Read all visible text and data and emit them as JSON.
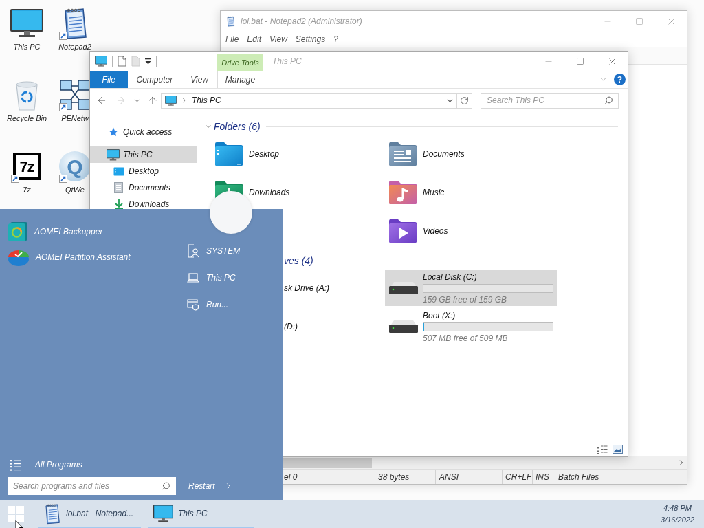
{
  "desktop": {
    "icons": [
      {
        "label": "This PC",
        "kind": "computer",
        "shortcut": false
      },
      {
        "label": "Recycle Bin",
        "kind": "recycle-bin",
        "shortcut": false
      },
      {
        "label": "7z",
        "kind": "archive",
        "shortcut": true,
        "logo_text": "7z"
      },
      {
        "label": "Notepad2",
        "kind": "notepad",
        "shortcut": true
      },
      {
        "label": "PENetw",
        "kind": "network",
        "shortcut": true
      },
      {
        "label": "QtWe",
        "kind": "bubble",
        "shortcut": true,
        "logo_text": "Q"
      }
    ]
  },
  "notepad": {
    "title": "lol.bat - Notepad2 (Administrator)",
    "menu": [
      "File",
      "Edit",
      "View",
      "Settings",
      "?"
    ],
    "status_bar": [
      "el 0",
      "38 bytes",
      "ANSI",
      "CR+LF",
      "INS",
      "Batch Files"
    ]
  },
  "explorer": {
    "title": "This PC",
    "contextual_group": "Drive Tools",
    "ribbon_tabs": [
      {
        "label": "File",
        "kind": "file"
      },
      {
        "label": "Computer",
        "kind": "tab"
      },
      {
        "label": "View",
        "kind": "tab"
      },
      {
        "label": "Manage",
        "kind": "contextual"
      }
    ],
    "help": "?",
    "back_disabled": false,
    "forward_disabled": true,
    "address": "This PC",
    "search_placeholder": "Search This PC",
    "navigation": [
      {
        "label": "Quick access",
        "kind": "star",
        "selected": false
      },
      {
        "label": "This PC",
        "kind": "computer",
        "selected": true,
        "children": [
          {
            "label": "Desktop",
            "kind": "desktop",
            "selected": false
          },
          {
            "label": "Documents",
            "kind": "documents",
            "selected": false
          },
          {
            "label": "Downloads",
            "kind": "downloads",
            "selected": false
          }
        ]
      }
    ],
    "groups": [
      {
        "title": "Folders (6)",
        "chevron": true,
        "columns": [
          [
            {
              "label": "Desktop",
              "kind": "desktop"
            },
            {
              "label": "Downloads",
              "kind": "downloads"
            }
          ],
          [
            {
              "label": "Documents",
              "kind": "documents"
            },
            {
              "label": "Music",
              "kind": "music"
            },
            {
              "label": "Videos",
              "kind": "videos"
            }
          ]
        ]
      },
      {
        "title": "ves (4)",
        "chevron": false,
        "columns": [
          [
            {
              "label": "sk Drive (A:)",
              "kind": "partial"
            },
            {
              "label": "(D:)",
              "kind": "partial"
            }
          ],
          [
            {
              "label": "Local Disk (C:)",
              "kind": "disk",
              "selected": true,
              "level": 0,
              "free": "159 GB free of 159 GB"
            },
            {
              "label": "Boot (X:)",
              "kind": "disk",
              "selected": false,
              "level": 0.004,
              "free": "507 MB free of 509 MB"
            }
          ]
        ]
      }
    ]
  },
  "start_menu": {
    "programs": [
      {
        "label": "AOMEI Backupper",
        "kind": "backupper"
      },
      {
        "label": "AOMEI Partition Assistant",
        "kind": "partition"
      }
    ],
    "places": [
      {
        "label": "SYSTEM",
        "kind": "user"
      },
      {
        "label": "This PC",
        "kind": "computer"
      },
      {
        "label": "Run...",
        "kind": "run"
      }
    ],
    "all_programs": "All Programs",
    "search_placeholder": "Search programs and files",
    "power": "Restart"
  },
  "taskbar": {
    "items": [
      {
        "label": "lol.bat - Notepad...",
        "kind": "notepad"
      },
      {
        "label": "This PC",
        "kind": "computer"
      }
    ],
    "time": "4:48 PM",
    "date": "3/16/2022"
  }
}
